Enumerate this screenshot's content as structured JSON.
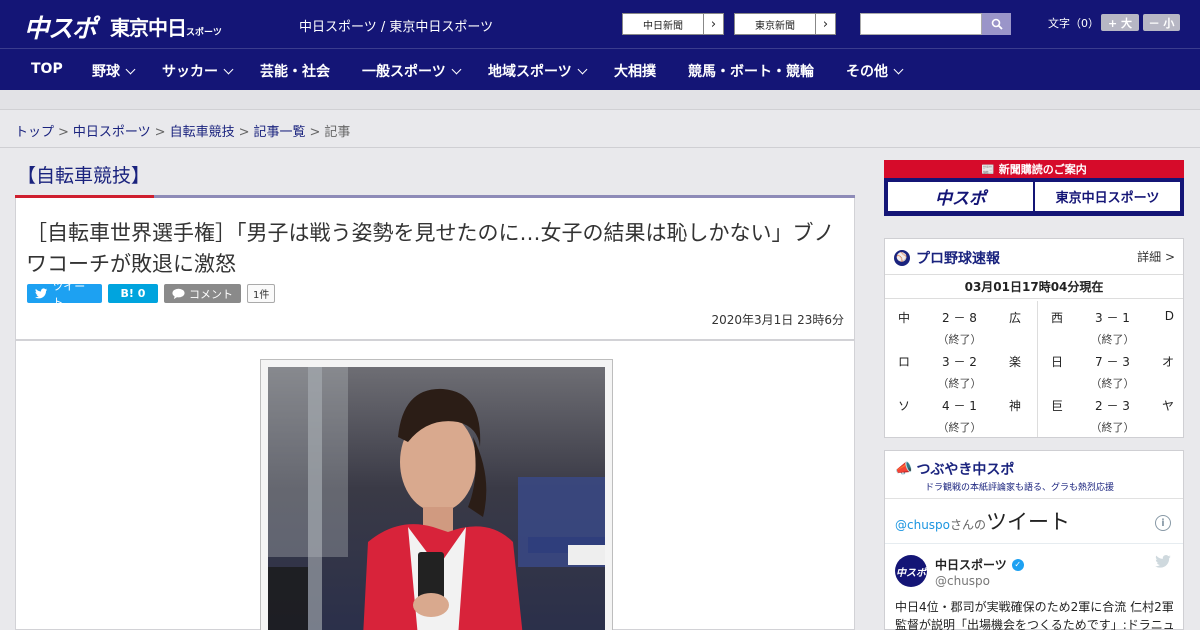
{
  "header": {
    "logo_chuspo": "中スポ",
    "logo_tokyo": "東京中日",
    "logo_tokyo_small": "スポーツ",
    "site_names": "中日スポーツ / 東京中日スポーツ",
    "paper_buttons": [
      "中日新聞",
      "東京新聞"
    ],
    "search_placeholder": "",
    "font_size_label": "文字（0）",
    "font_larger": "+ 大",
    "font_smaller": "－ 小"
  },
  "nav": {
    "items": [
      {
        "label": "TOP",
        "dropdown": false
      },
      {
        "label": "野球",
        "dropdown": true
      },
      {
        "label": "サッカー",
        "dropdown": true
      },
      {
        "label": "芸能・社会",
        "dropdown": false
      },
      {
        "label": "一般スポーツ",
        "dropdown": true
      },
      {
        "label": "地域スポーツ",
        "dropdown": true
      },
      {
        "label": "大相撲",
        "dropdown": false
      },
      {
        "label": "競馬・ボート・競輪",
        "dropdown": false
      },
      {
        "label": "その他",
        "dropdown": true
      }
    ]
  },
  "breadcrumb": [
    "トップ",
    "中日スポーツ",
    "自転車競技",
    "記事一覧",
    "記事"
  ],
  "article": {
    "category": "【自転車競技】",
    "headline": "［自転車世界選手権］「男子は戦う姿勢を見せたのに…女子の結果は恥しかない」ブノワコーチが敗退に激怒",
    "tweet_label": "ツイート",
    "hatena_label": "B! 0",
    "comment_label": "コメント",
    "comment_count": "1件",
    "date": "2020年3月1日 23時6分"
  },
  "sidebar": {
    "subscribe_label": "新聞購読のご案内",
    "subscribe_logos": [
      "中スポ",
      "東京中日スポーツ"
    ],
    "baseball": {
      "title": "プロ野球速報",
      "detail": "詳細 >",
      "updated": "03月01日17時04分現在",
      "games": [
        {
          "home": "中",
          "score": "2 － 8",
          "away": "広",
          "status": "（終了）"
        },
        {
          "home": "ロ",
          "score": "3 － 2",
          "away": "楽",
          "status": "（終了）"
        },
        {
          "home": "ソ",
          "score": "4 － 1",
          "away": "神",
          "status": "（終了）"
        },
        {
          "home": "西",
          "score": "3 － 1",
          "away": "D",
          "status": "（終了）"
        },
        {
          "home": "日",
          "score": "7 － 3",
          "away": "オ",
          "status": "（終了）"
        },
        {
          "home": "巨",
          "score": "2 － 3",
          "away": "ヤ",
          "status": "（終了）"
        }
      ]
    },
    "tweets": {
      "title": "つぶやき中スポ",
      "subtitle": "ドラ観戦の本紙評論家も語る、グラも熱烈応援",
      "widget_handle": "@chuspo",
      "widget_san": "さんの",
      "widget_tweet": "ツイート",
      "account_name": "中日スポーツ",
      "account_handle": "@chuspo",
      "avatar_text": "中スポ",
      "text_line1": "中日4位・郡司が実戦確保のため2軍に合流 仁村2軍",
      "text_line2": "監督が説明「出場機会をつくるためです」:ドラニュ"
    }
  },
  "colors": {
    "header_bg": "#141576",
    "accent_red": "#cf1f2f",
    "link": "#1a237e",
    "twitter": "#1da1f2"
  }
}
